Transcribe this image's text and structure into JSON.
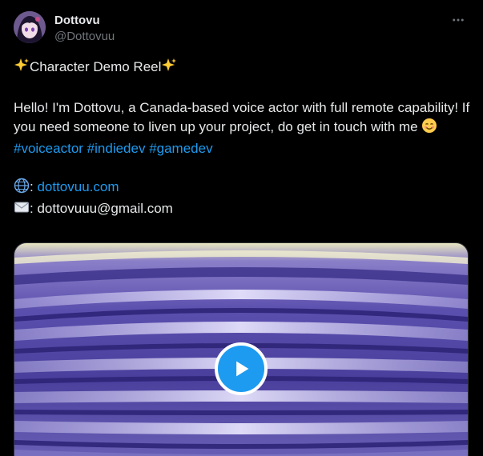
{
  "author": {
    "display_name": "Dottovu",
    "handle": "@Dottovuu",
    "avatar_icon": "anime-girl-avatar"
  },
  "tweet": {
    "title_text": "Character Demo Reel",
    "title_emoji": "sparkles-icon",
    "paragraph": "Hello! I'm Dottovu, a Canada-based voice actor with full remote capability! If you need someone to liven up your project, do get in touch with me",
    "paragraph_emoji": "smiling-face-icon",
    "hashtags": [
      "#voiceactor",
      "#indiedev",
      "#gamedev"
    ],
    "website_label": ": ",
    "website": "dottovuu.com",
    "email_label": ": dottovuuu@gmail.com"
  },
  "media": {
    "type": "video",
    "play_icon": "play-icon"
  },
  "colors": {
    "background": "#000000",
    "text": "#e7e9ea",
    "muted": "#71767b",
    "link": "#1d9bf0",
    "accent": "#1d9bf0"
  },
  "icons": {
    "more": "more-options-icon",
    "globe": "globe-icon",
    "envelope": "envelope-icon"
  }
}
